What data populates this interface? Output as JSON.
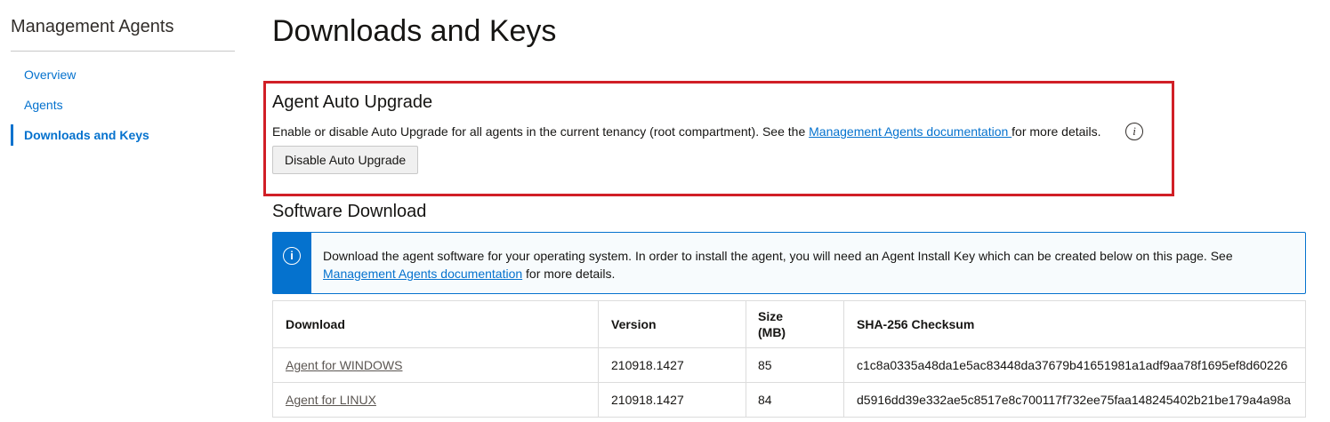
{
  "sidebar": {
    "title": "Management Agents",
    "items": [
      {
        "label": "Overview",
        "active": false
      },
      {
        "label": "Agents",
        "active": false
      },
      {
        "label": "Downloads and Keys",
        "active": true
      }
    ]
  },
  "page": {
    "title": "Downloads and Keys"
  },
  "auto_upgrade": {
    "heading": "Agent Auto Upgrade",
    "desc_before": "Enable or disable Auto Upgrade for all agents in the current tenancy (root compartment). See the ",
    "desc_link": "Management Agents documentation ",
    "desc_after": "for more details.",
    "info_glyph": "i",
    "button_label": "Disable Auto Upgrade"
  },
  "software_download": {
    "heading": "Software Download",
    "notice": {
      "icon": "info-icon",
      "icon_glyph": "i",
      "text_before": "Download the agent software for your operating system. In order to install the agent, you will need an Agent Install Key which can be created below on this page. See ",
      "link": "Management Agents documentation",
      "text_after": " for more details."
    },
    "table": {
      "headers": [
        "Download",
        "Version",
        "Size (MB)",
        "SHA-256 Checksum"
      ],
      "rows": [
        {
          "download": "Agent for WINDOWS",
          "version": "210918.1427",
          "size": "85",
          "checksum": "c1c8a0335a48da1e5ac83448da37679b41651981a1adf9aa78f1695ef8d60226"
        },
        {
          "download": "Agent for LINUX",
          "version": "210918.1427",
          "size": "84",
          "checksum": "d5916dd39e332ae5c8517e8c700117f732ee75faa148245402b21be179a4a98a"
        }
      ]
    }
  },
  "colors": {
    "accent": "#0572ce",
    "highlight_border": "#d11f26"
  }
}
